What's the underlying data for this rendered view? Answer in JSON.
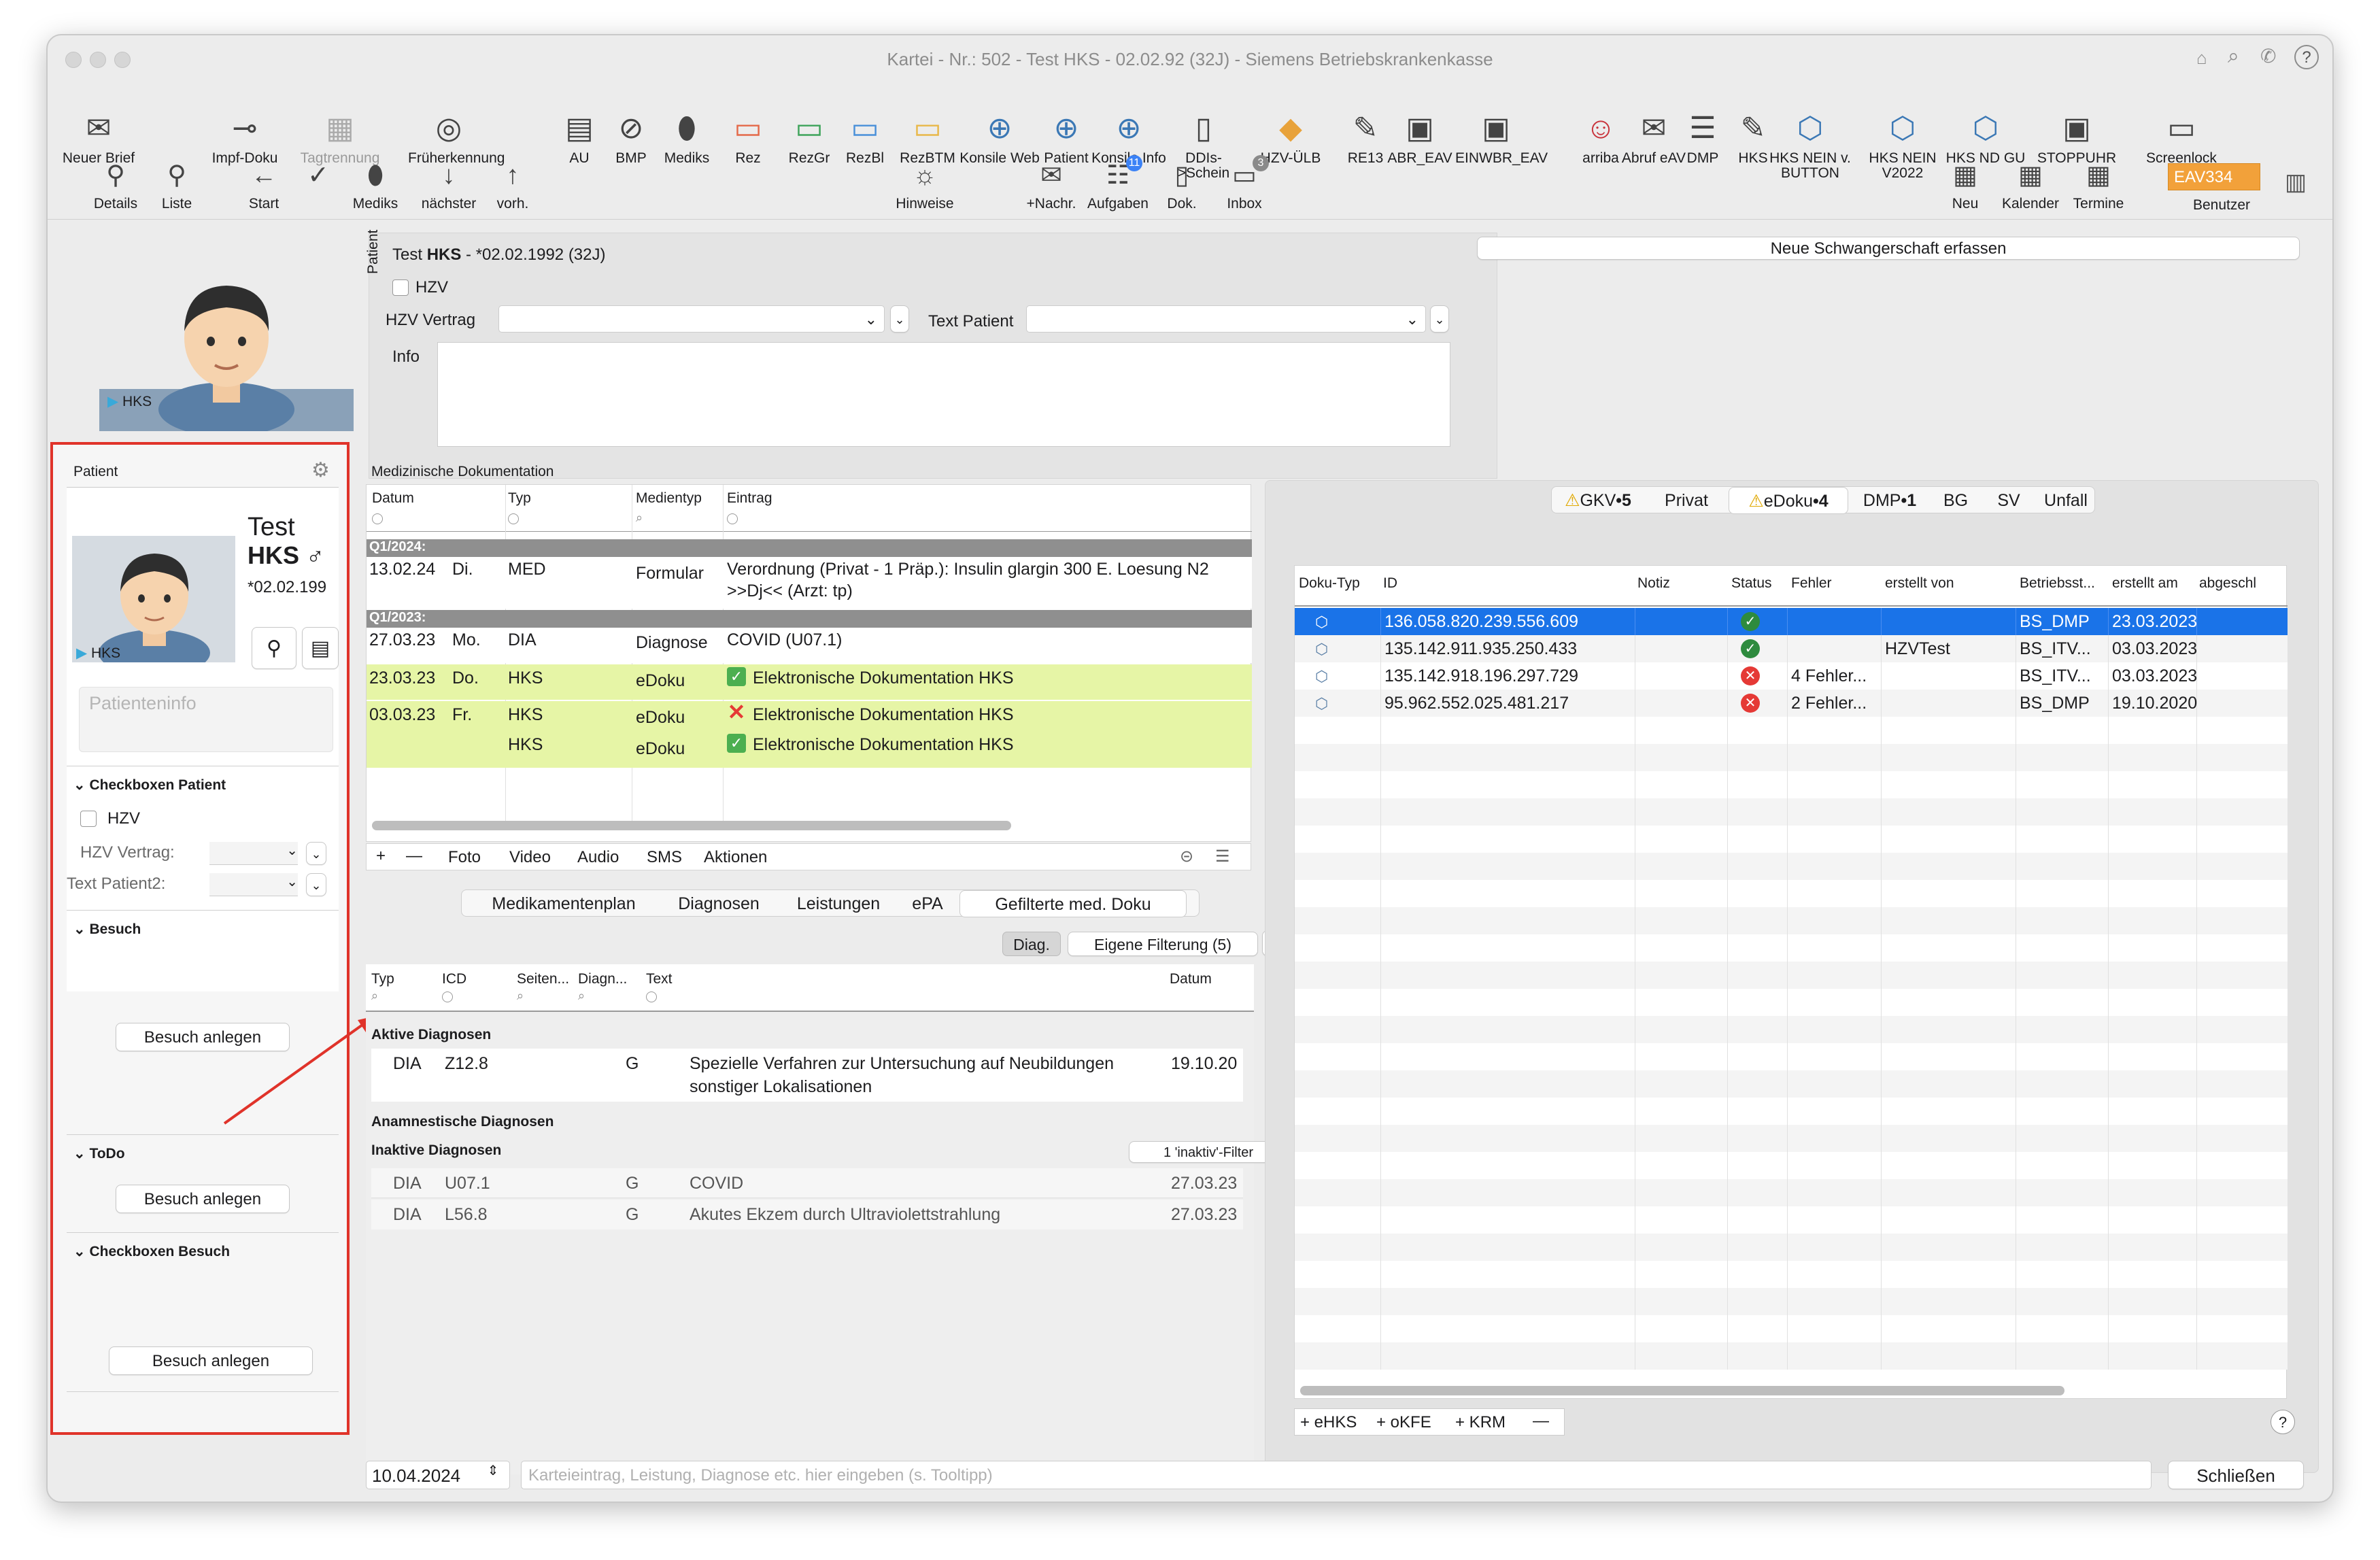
{
  "window": {
    "title": "Kartei - Nr.: 502 - Test HKS - 02.02.92 (32J) - Siemens Betriebskrankenkasse"
  },
  "toolbar": [
    {
      "label": "Neuer Brief",
      "icon": "new-letter-icon"
    },
    {
      "label": "Impf-Doku",
      "icon": "syringe-icon"
    },
    {
      "label": "Tagtrennung",
      "icon": "calendar-19-icon",
      "disabled": true
    },
    {
      "label": "Früherkennung",
      "icon": "radar-icon"
    },
    {
      "label": "AU",
      "icon": "au-form-icon"
    },
    {
      "label": "BMP",
      "icon": "pill-plan-icon"
    },
    {
      "label": "Mediks",
      "icon": "pills-icon"
    },
    {
      "label": "Rez",
      "icon": "prescription-red-icon"
    },
    {
      "label": "RezGr",
      "icon": "prescription-green-icon"
    },
    {
      "label": "RezBl",
      "icon": "prescription-blue-icon"
    },
    {
      "label": "RezBTM",
      "icon": "prescription-yellow-icon"
    },
    {
      "label": "Konsile Web",
      "icon": "globe-icon"
    },
    {
      "label": "Patient",
      "icon": "globe-patient-icon"
    },
    {
      "label": "Konsile Info",
      "icon": "globe-info-icon"
    },
    {
      "label": "DDIs->Schein",
      "icon": "document-icon"
    },
    {
      "label": "HZV-ÜLB",
      "icon": "hzv-icon"
    },
    {
      "label": "RE13",
      "icon": "edit-form-icon"
    },
    {
      "label": "ABR_EAV",
      "icon": "clipboard-add-icon"
    },
    {
      "label": "EINWBR_EAV",
      "icon": "clipboard-add-icon"
    },
    {
      "label": "arriba",
      "icon": "arriba-icon"
    },
    {
      "label": "Abruf eAV",
      "icon": "mail-icon"
    },
    {
      "label": "DMP",
      "icon": "list-icon"
    },
    {
      "label": "HKS",
      "icon": "edit-form-icon"
    },
    {
      "label": "HKS NEIN v. BUTTON",
      "icon": "molecule-icon"
    },
    {
      "label": "HKS NEIN V2022",
      "icon": "molecule-icon"
    },
    {
      "label": "HKS ND GU",
      "icon": "molecule-icon"
    },
    {
      "label": "STOPPUHR",
      "icon": "clipboard-add-icon"
    },
    {
      "label": "Screenlock",
      "icon": "monitor-lock-icon"
    }
  ],
  "toolbar2_left": [
    {
      "label": "Details",
      "icon": "person-icon"
    },
    {
      "label": "Liste",
      "icon": "person-add-icon"
    },
    {
      "label": "Start",
      "icon": "arrow-left-circle-icon"
    },
    {
      "label": "",
      "icon": "check-circle-icon"
    },
    {
      "label": "Mediks",
      "icon": "pills-icon"
    },
    {
      "label": "nächster",
      "icon": "down-arrow-icon"
    },
    {
      "label": "vorh.",
      "icon": "up-arrow-icon"
    }
  ],
  "toolbar2_mid": [
    {
      "label": "Hinweise",
      "icon": "lamp-icon"
    },
    {
      "label": "+Nachr.",
      "icon": "message-icon"
    },
    {
      "label": "Aufgaben",
      "icon": "tasks-icon",
      "badge": "11"
    },
    {
      "label": "Dok.",
      "icon": "book-icon"
    },
    {
      "label": "Inbox",
      "icon": "inbox-icon",
      "badge": "3"
    }
  ],
  "toolbar2_right": [
    {
      "label": "Neu",
      "icon": "calendar-add-icon"
    },
    {
      "label": "Kalender",
      "icon": "calendar-31-icon"
    },
    {
      "label": "Termine",
      "icon": "calendar-list-icon"
    }
  ],
  "user": {
    "badge": "EAV334",
    "label": "Benutzer"
  },
  "avatar_top": {
    "label": "HKS"
  },
  "patient_header": {
    "side_label": "Patient",
    "name_prefix": "Test ",
    "name_bold": "HKS",
    "dob": " - *02.02.1992 (32J)",
    "hzv_checkbox": "HZV",
    "hzv_vertrag_label": "HZV Vertrag",
    "text_patient_label": "Text Patient",
    "info_label": "Info"
  },
  "pregnancy_button": "Neue Schwangerschaft erfassen",
  "left_panel": {
    "title": "Patient",
    "first_name": "Test",
    "last_name": "HKS",
    "gender": "♂",
    "dob": "*02.02.199",
    "avatar_label": "HKS",
    "info_placeholder": "Patienteninfo",
    "section1": "Checkboxen Patient",
    "hzv": "HZV",
    "hzv_vertrag": "HZV Vertrag:",
    "text_patient2": "Text Patient2:",
    "section2": "Besuch",
    "visit_button": "Besuch anlegen",
    "section3": "ToDo",
    "section4": "Checkboxen Besuch"
  },
  "med_doku": {
    "title": "Medizinische Dokumentation",
    "columns": [
      "Datum",
      "Typ",
      "Medientyp",
      "Eintrag"
    ],
    "group1": "Q1/2024:",
    "group2": "Q1/2023:",
    "rows": [
      {
        "date": "13.02.24",
        "day": "Di.",
        "typ": "MED",
        "medien": "Formular",
        "entry": "Verordnung (Privat - 1 Präp.): Insulin glargin 300 E. Loesung N2",
        "entry2": ">>Dj<< (Arzt: tp)",
        "mark": ""
      },
      {
        "date": "27.03.23",
        "day": "Mo.",
        "typ": "DIA",
        "medien": "Diagnose",
        "entry": "COVID (U07.1)",
        "mark": ""
      },
      {
        "date": "23.03.23",
        "day": "Do.",
        "typ": "HKS",
        "medien": "eDoku",
        "entry": "Elektronische Dokumentation HKS",
        "mark": "check"
      },
      {
        "date": "03.03.23",
        "day": "Fr.",
        "typ": "HKS",
        "medien": "eDoku",
        "entry": "Elektronische Dokumentation HKS",
        "mark": "cross"
      },
      {
        "date": "",
        "day": "",
        "typ": "HKS",
        "medien": "eDoku",
        "entry": "Elektronische Dokumentation HKS",
        "mark": "check"
      }
    ],
    "bottom_buttons": [
      "+",
      "—",
      "Foto",
      "Video",
      "Audio",
      "SMS",
      "Aktionen"
    ]
  },
  "lower_tabs": [
    "Medikamentenplan",
    "Diagnosen",
    "Leistungen",
    "ePA",
    "Gefilterte med. Doku"
  ],
  "filter": {
    "diag": "Diag.",
    "own": "Eigene Filterung (5)"
  },
  "diag_table": {
    "columns": [
      "Typ",
      "ICD",
      "Seiten...",
      "Diagn...",
      "Text",
      "Datum"
    ],
    "active_title": "Aktive Diagnosen",
    "active": [
      {
        "typ": "DIA",
        "icd": "Z12.8",
        "side": "",
        "diag": "G",
        "text": "Spezielle Verfahren zur Untersuchung auf Neubildungen",
        "text2": "sonstiger Lokalisationen",
        "date": "19.10.20"
      }
    ],
    "anamnestic_title": "Anamnestische Diagnosen",
    "inactive_title": "Inaktive Diagnosen",
    "inactive_filter": "1 'inaktiv'-Filter",
    "inactive": [
      {
        "typ": "DIA",
        "icd": "U07.1",
        "diag": "G",
        "text": "COVID",
        "date": "27.03.23"
      },
      {
        "typ": "DIA",
        "icd": "L56.8",
        "diag": "G",
        "text": "Akutes Ekzem durch Ultraviolettstrahlung",
        "date": "27.03.23"
      }
    ]
  },
  "right_tabs": [
    {
      "label": "GKV",
      "count": "5",
      "warn": true
    },
    {
      "label": "Privat",
      "count": "",
      "warn": false
    },
    {
      "label": "eDoku",
      "count": "4",
      "warn": true,
      "active": true
    },
    {
      "label": "DMP",
      "count": "1",
      "warn": false
    },
    {
      "label": "BG",
      "count": "",
      "warn": false
    },
    {
      "label": "SV",
      "count": "",
      "warn": false
    },
    {
      "label": "Unfall",
      "count": "",
      "warn": false
    }
  ],
  "edoku_table": {
    "columns": [
      "Doku-Typ",
      "ID",
      "Notiz",
      "Status",
      "Fehler",
      "erstellt von",
      "Betriebsst...",
      "erstellt am",
      "abgeschl"
    ],
    "rows": [
      {
        "id": "136.058.820.239.556.609",
        "status": "ok",
        "fehler": "",
        "von": "",
        "betrieb": "BS_DMP",
        "am": "23.03.2023",
        "selected": true
      },
      {
        "id": "135.142.911.935.250.433",
        "status": "ok",
        "fehler": "",
        "von": "HZVTest",
        "betrieb": "BS_ITV...",
        "am": "03.03.2023",
        "selected": false
      },
      {
        "id": "135.142.918.196.297.729",
        "status": "err",
        "fehler": "4 Fehler...",
        "von": "",
        "betrieb": "BS_ITV...",
        "am": "03.03.2023",
        "selected": false
      },
      {
        "id": "95.962.552.025.481.217",
        "status": "err",
        "fehler": "2 Fehler...",
        "von": "",
        "betrieb": "BS_DMP",
        "am": "19.10.2020",
        "selected": false
      }
    ],
    "buttons": [
      "+ eHKS",
      "+ oKFE",
      "+ KRM",
      "—"
    ],
    "help": "?"
  },
  "bottom": {
    "date": "10.04.2024",
    "input_placeholder": "Karteieintrag, Leistung, Diagnose etc. hier eingeben (s. Tooltipp)",
    "close": "Schließen"
  },
  "colors": {
    "highlight_box": "#e0332a",
    "selected_row": "#1a73e8",
    "green_row": "#e6f5a6",
    "group_bar": "#8f8f8f",
    "user_badge": "#f2a13a"
  }
}
